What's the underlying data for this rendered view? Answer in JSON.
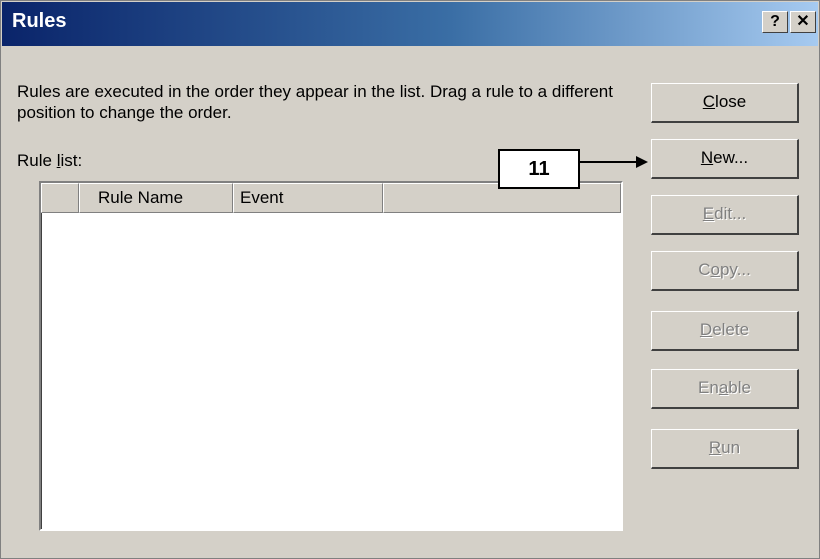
{
  "window": {
    "title": "Rules"
  },
  "titlebar": {
    "help_label": "?",
    "close_label": "✕"
  },
  "description": "Rules are executed in the order they appear in the list.  Drag a rule to a different position to change the order.",
  "rule_list": {
    "label_prefix": "Rule ",
    "label_accel": "l",
    "label_suffix": "ist:",
    "columns": [
      "",
      "Rule Name",
      "Event",
      ""
    ]
  },
  "buttons": [
    {
      "pre": "",
      "accel": "C",
      "post": "lose",
      "enabled": true
    },
    {
      "pre": "",
      "accel": "N",
      "post": "ew...",
      "enabled": true
    },
    {
      "pre": "",
      "accel": "E",
      "post": "dit...",
      "enabled": false
    },
    {
      "pre": "C",
      "accel": "o",
      "post": "py...",
      "enabled": false
    },
    {
      "pre": "",
      "accel": "D",
      "post": "elete",
      "enabled": false
    },
    {
      "pre": "En",
      "accel": "a",
      "post": "ble",
      "enabled": false
    },
    {
      "pre": "",
      "accel": "R",
      "post": "un",
      "enabled": false
    }
  ],
  "callout": {
    "label": "11"
  },
  "colors": {
    "title_gradient_start": "#0a246a",
    "title_gradient_end": "#a6caf0",
    "face": "#d4d0c8"
  }
}
